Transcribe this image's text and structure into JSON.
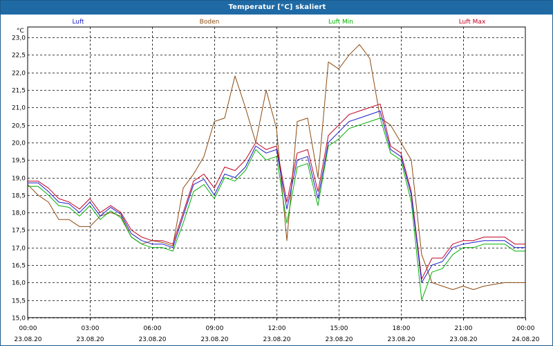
{
  "window": {
    "title": "Temperatur [°C] skaliert"
  },
  "colors": {
    "title_bar": "#1f6aa5",
    "Luft": "#1a1acc",
    "Boden": "#8b4a10",
    "Luft Min": "#00b000",
    "Luft Max": "#c00020",
    "grid": "#000000"
  },
  "chart_data": {
    "type": "line",
    "title": "Temperatur [°C] skaliert",
    "ylabel": "°C",
    "xlabel": "",
    "ylim": [
      15.0,
      23.3
    ],
    "xlim": [
      0,
      24
    ],
    "grid": true,
    "legend_position": "top",
    "y_ticks": [
      "23,0",
      "22,5",
      "22,0",
      "21,5",
      "21,0",
      "20,5",
      "20,0",
      "19,5",
      "19,0",
      "18,5",
      "18,0",
      "17,5",
      "17,0",
      "16,5",
      "16,0",
      "15,5",
      "15,0"
    ],
    "y_tick_values": [
      23.0,
      22.5,
      22.0,
      21.5,
      21.0,
      20.5,
      20.0,
      19.5,
      19.0,
      18.5,
      18.0,
      17.5,
      17.0,
      16.5,
      16.0,
      15.5,
      15.0
    ],
    "x_ticks": [
      {
        "time": "00:00",
        "date": "23.08.20"
      },
      {
        "time": "03:00",
        "date": "23.08.20"
      },
      {
        "time": "06:00",
        "date": "23.08.20"
      },
      {
        "time": "09:00",
        "date": "23.08.20"
      },
      {
        "time": "12:00",
        "date": "23.08.20"
      },
      {
        "time": "15:00",
        "date": "23.08.20"
      },
      {
        "time": "18:00",
        "date": "23.08.20"
      },
      {
        "time": "21:00",
        "date": "23.08.20"
      },
      {
        "time": "00:00",
        "date": "24.08.20"
      }
    ],
    "x": [
      0,
      0.5,
      1,
      1.5,
      2,
      2.5,
      3,
      3.5,
      4,
      4.5,
      5,
      5.5,
      6,
      6.5,
      7,
      7.5,
      8,
      8.5,
      9,
      9.5,
      10,
      10.5,
      11,
      11.5,
      12,
      12.5,
      13,
      13.5,
      14,
      14.5,
      15,
      15.5,
      16,
      16.5,
      17,
      17.5,
      18,
      18.5,
      19,
      19.5,
      20,
      20.5,
      21,
      21.5,
      22,
      22.5,
      23,
      23.5,
      24
    ],
    "series": [
      {
        "name": "Luft",
        "values": [
          18.85,
          18.85,
          18.6,
          18.3,
          18.25,
          18.0,
          18.3,
          17.9,
          18.15,
          17.95,
          17.4,
          17.2,
          17.1,
          17.1,
          17.0,
          17.9,
          18.8,
          18.95,
          18.5,
          19.1,
          19.0,
          19.3,
          19.9,
          19.7,
          19.8,
          18.1,
          19.5,
          19.6,
          18.4,
          20.0,
          20.3,
          20.6,
          20.7,
          20.8,
          20.9,
          19.8,
          19.6,
          18.5,
          16.0,
          16.5,
          16.6,
          17.0,
          17.1,
          17.15,
          17.2,
          17.2,
          17.2,
          17.0,
          17.0
        ]
      },
      {
        "name": "Boden",
        "values": [
          18.8,
          18.5,
          18.3,
          17.8,
          17.8,
          17.6,
          17.6,
          17.9,
          18.0,
          17.9,
          17.3,
          17.1,
          17.2,
          17.15,
          17.05,
          18.7,
          19.1,
          19.6,
          20.6,
          20.7,
          21.9,
          21.0,
          20.0,
          21.5,
          20.4,
          17.2,
          20.6,
          20.7,
          19.0,
          22.3,
          22.1,
          22.5,
          22.8,
          22.4,
          20.7,
          20.5,
          20.0,
          19.5,
          16.8,
          16.0,
          15.9,
          15.8,
          15.9,
          15.8,
          15.9,
          15.95,
          16.0,
          16.0,
          16.0
        ]
      },
      {
        "name": "Luft Min",
        "values": [
          18.75,
          18.75,
          18.5,
          18.2,
          18.15,
          17.9,
          18.2,
          17.8,
          18.05,
          17.85,
          17.3,
          17.1,
          17.0,
          17.0,
          16.9,
          17.7,
          18.6,
          18.8,
          18.4,
          19.0,
          18.9,
          19.2,
          19.8,
          19.5,
          19.6,
          17.7,
          19.3,
          19.4,
          18.2,
          19.9,
          20.1,
          20.4,
          20.5,
          20.6,
          20.7,
          19.7,
          19.5,
          18.3,
          15.5,
          16.3,
          16.4,
          16.8,
          17.0,
          17.0,
          17.1,
          17.1,
          17.1,
          16.9,
          16.9
        ]
      },
      {
        "name": "Luft Max",
        "values": [
          18.9,
          18.9,
          18.7,
          18.4,
          18.3,
          18.1,
          18.4,
          18.0,
          18.2,
          18.0,
          17.5,
          17.3,
          17.2,
          17.2,
          17.1,
          18.0,
          18.9,
          19.1,
          18.7,
          19.3,
          19.2,
          19.5,
          20.0,
          19.8,
          19.9,
          18.3,
          19.7,
          19.8,
          18.6,
          20.2,
          20.5,
          20.8,
          20.9,
          21.0,
          21.1,
          19.9,
          19.7,
          18.6,
          16.1,
          16.7,
          16.7,
          17.1,
          17.2,
          17.2,
          17.3,
          17.3,
          17.3,
          17.1,
          17.1
        ]
      }
    ]
  }
}
